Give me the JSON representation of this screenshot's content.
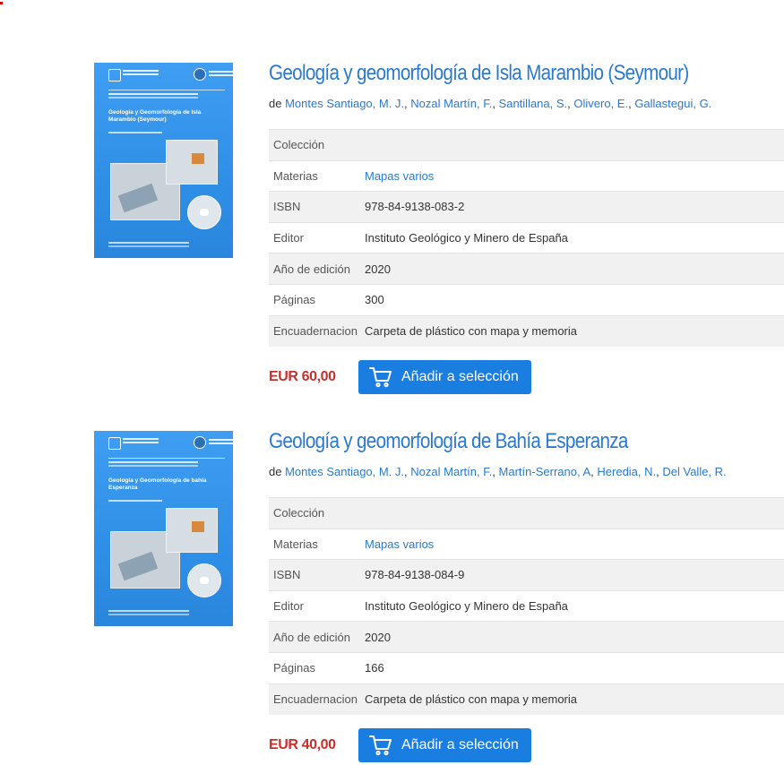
{
  "products": [
    {
      "cover": {
        "title": "Geología y Geomorfología de Isla Marambio (Seymour)"
      },
      "title": "Geología y geomorfología de Isla Marambio (Seymour)",
      "by_label": "de",
      "authors": [
        "Montes Santiago, M. J.",
        "Nozal Martín, F.",
        "Santillana, S.",
        "Olivero, E.",
        "Gallastegui, G."
      ],
      "details": {
        "coleccion_label": "Colección",
        "coleccion_value": "",
        "materias_label": "Materias",
        "materias_value": "Mapas varios",
        "isbn_label": "ISBN",
        "isbn_value": "978-84-9138-083-2",
        "editor_label": "Editor",
        "editor_value": "Instituto Geológico y Minero de España",
        "anio_label": "Año de edición",
        "anio_value": "2020",
        "paginas_label": "Páginas",
        "paginas_value": "300",
        "encuadernacion_label": "Encuadernacion",
        "encuadernacion_value": "Carpeta de plástico con mapa y memoria"
      },
      "price": "EUR 60,00",
      "button_label": "Añadir a selección"
    },
    {
      "cover": {
        "title": "Geología y Geomorfología de bahía Esperanza"
      },
      "title": "Geología y geomorfología de Bahía Esperanza",
      "by_label": "de",
      "authors": [
        "Montes Santiago, M. J.",
        "Nozal Martín, F.",
        "Martín-Serrano, A",
        "Heredia, N.",
        "Del Valle, R."
      ],
      "details": {
        "coleccion_label": "Colección",
        "coleccion_value": "",
        "materias_label": "Materias",
        "materias_value": "Mapas varios",
        "isbn_label": "ISBN",
        "isbn_value": "978-84-9138-084-9",
        "editor_label": "Editor",
        "editor_value": "Instituto Geológico y Minero de España",
        "anio_label": "Año de edición",
        "anio_value": "2020",
        "paginas_label": "Páginas",
        "paginas_value": "166",
        "encuadernacion_label": "Encuadernacion",
        "encuadernacion_value": "Carpeta de plástico con mapa y memoria"
      },
      "price": "EUR 40,00",
      "button_label": "Añadir a selección"
    }
  ],
  "colors": {
    "link": "#2979d0",
    "price": "#c9302c",
    "button": "#1a7de0",
    "row_alt": "#f1f1f1"
  },
  "icons": {
    "cart": "cart-icon"
  }
}
